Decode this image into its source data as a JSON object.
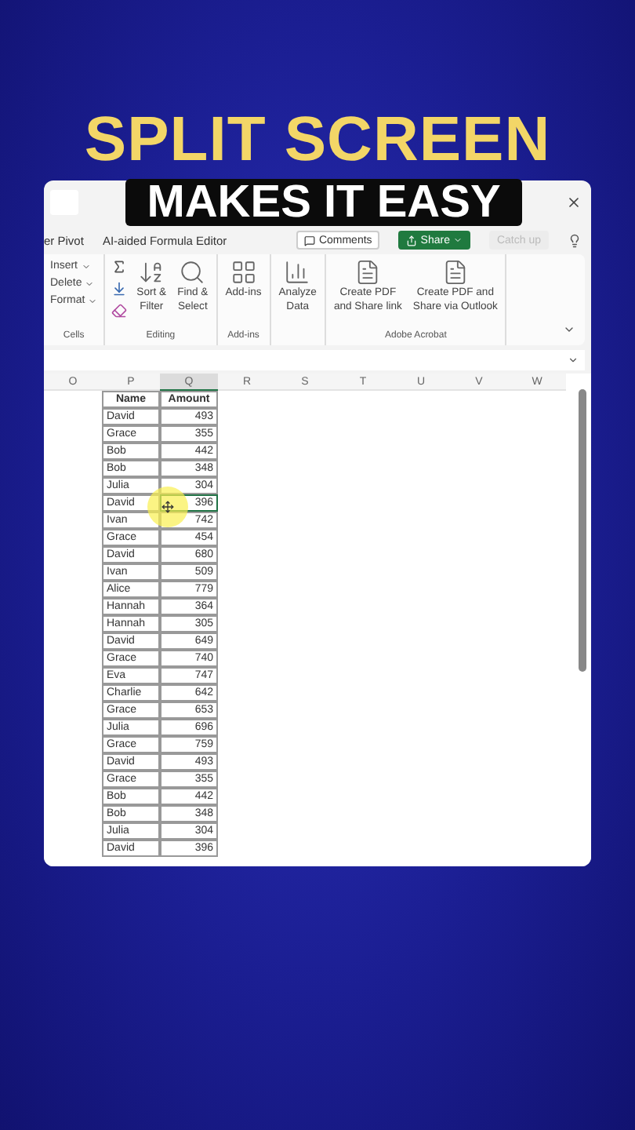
{
  "headline": "SPLIT SCREEN",
  "caption": "MAKES IT EASY",
  "tabs": [
    {
      "label": "er Pivot"
    },
    {
      "label": "AI-aided Formula Editor"
    }
  ],
  "actions": [
    {
      "label": "Comments",
      "kind": "outline"
    },
    {
      "label": "Share",
      "kind": "primary"
    },
    {
      "label": "Catch up",
      "kind": "disabled"
    }
  ],
  "ribbon_groups": [
    {
      "label": "Cells",
      "kind": "list",
      "items": [
        {
          "label": "Insert"
        },
        {
          "label": "Delete"
        },
        {
          "label": "Format"
        }
      ]
    },
    {
      "label": "Editing",
      "kind": "editing",
      "items": [
        {
          "lines": [
            "Sort &",
            "Filter"
          ],
          "kind": "sort"
        },
        {
          "lines": [
            "Find &",
            "Select"
          ],
          "kind": "find"
        }
      ]
    },
    {
      "label": "Add-ins",
      "kind": "big",
      "items": [
        {
          "lines": [
            "Add-ins"
          ],
          "kind": "addins"
        }
      ]
    },
    {
      "kind": "big",
      "items": [
        {
          "lines": [
            "Analyze",
            "Data"
          ],
          "kind": "analyze"
        }
      ]
    },
    {
      "label": "Adobe Acrobat",
      "kind": "big",
      "items": [
        {
          "lines": [
            "Create PDF",
            "and Share link"
          ],
          "kind": "pdf"
        },
        {
          "lines": [
            "Create PDF and",
            "Share via Outlook"
          ],
          "kind": "pdf"
        }
      ]
    }
  ],
  "columns": [
    {
      "label": "O",
      "selected": false
    },
    {
      "label": "P",
      "selected": false
    },
    {
      "label": "Q",
      "selected": true
    },
    {
      "label": "R",
      "selected": false
    },
    {
      "label": "S",
      "selected": false
    },
    {
      "label": "T",
      "selected": false
    },
    {
      "label": "U",
      "selected": false
    },
    {
      "label": "V",
      "selected": false
    },
    {
      "label": "W",
      "selected": false
    }
  ],
  "table": {
    "headers": [
      "Name",
      "Amount"
    ],
    "rows": [
      {
        "name": "David",
        "amount": "493",
        "selected": false
      },
      {
        "name": "Grace",
        "amount": "355",
        "selected": false
      },
      {
        "name": "Bob",
        "amount": "442",
        "selected": false
      },
      {
        "name": "Bob",
        "amount": "348",
        "selected": false
      },
      {
        "name": "Julia",
        "amount": "304",
        "selected": false
      },
      {
        "name": "David",
        "amount": "396",
        "selected": true
      },
      {
        "name": "Ivan",
        "amount": "742",
        "selected": false
      },
      {
        "name": "Grace",
        "amount": "454",
        "selected": false
      },
      {
        "name": "David",
        "amount": "680",
        "selected": false
      },
      {
        "name": "Ivan",
        "amount": "509",
        "selected": false
      },
      {
        "name": "Alice",
        "amount": "779",
        "selected": false
      },
      {
        "name": "Hannah",
        "amount": "364",
        "selected": false
      },
      {
        "name": "Hannah",
        "amount": "305",
        "selected": false
      },
      {
        "name": "David",
        "amount": "649",
        "selected": false
      },
      {
        "name": "Grace",
        "amount": "740",
        "selected": false
      },
      {
        "name": "Eva",
        "amount": "747",
        "selected": false
      },
      {
        "name": "Charlie",
        "amount": "642",
        "selected": false
      },
      {
        "name": "Grace",
        "amount": "653",
        "selected": false
      },
      {
        "name": "Julia",
        "amount": "696",
        "selected": false
      },
      {
        "name": "Grace",
        "amount": "759",
        "selected": false
      },
      {
        "name": "David",
        "amount": "493",
        "selected": false
      },
      {
        "name": "Grace",
        "amount": "355",
        "selected": false
      },
      {
        "name": "Bob",
        "amount": "442",
        "selected": false
      },
      {
        "name": "Bob",
        "amount": "348",
        "selected": false
      },
      {
        "name": "Julia",
        "amount": "304",
        "selected": false
      },
      {
        "name": "David",
        "amount": "396",
        "selected": false
      }
    ]
  }
}
